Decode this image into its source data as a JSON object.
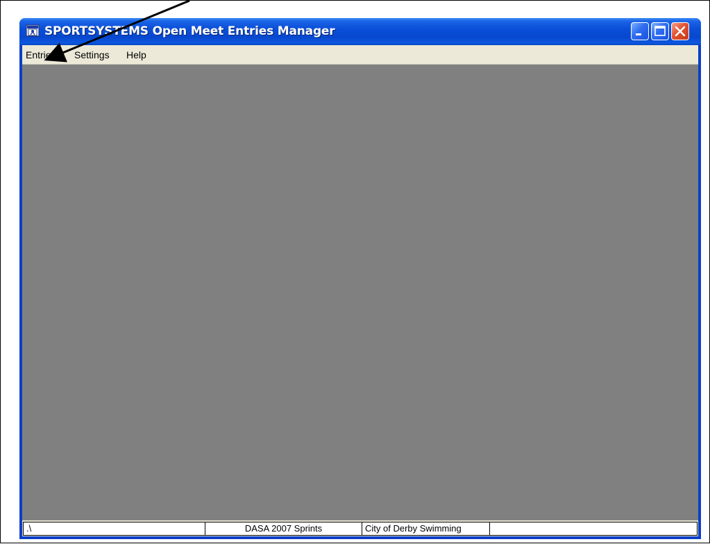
{
  "window": {
    "title": "SPORTSYSTEMS Open Meet Entries Manager",
    "app_icon": "sportsystems-app-icon",
    "controls": {
      "minimize": "minimize-icon",
      "maximize": "maximize-icon",
      "close": "close-icon"
    },
    "colors": {
      "titlebar": "#0848cf",
      "client_background": "#808080",
      "menubar": "#ece9d8",
      "close_button": "#e2522f"
    }
  },
  "menubar": {
    "items": [
      {
        "label": "Entries"
      },
      {
        "label": "Settings"
      },
      {
        "label": "Help"
      }
    ]
  },
  "statusbar": {
    "panes": [
      {
        "text": ".\\"
      },
      {
        "text": "DASA 2007 Sprints"
      },
      {
        "text": "City of Derby Swimming"
      },
      {
        "text": ""
      }
    ]
  },
  "annotation": {
    "arrow": "callout-arrow-pointing-to-entries-menu"
  }
}
